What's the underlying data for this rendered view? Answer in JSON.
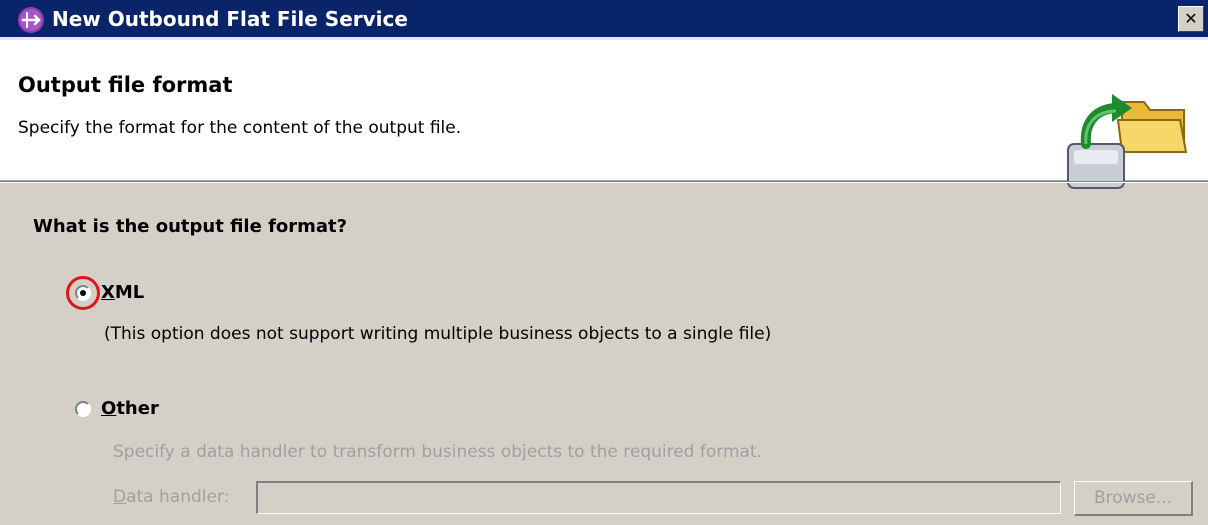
{
  "window": {
    "title": "New Outbound Flat File Service",
    "close_glyph": "✕",
    "title_icon": "wizard-app-icon",
    "colors": {
      "titlebar": "#0a246a",
      "panel": "#d4d0c8",
      "highlight_ring": "#e0141e",
      "disabled_text": "#a0a0a0"
    }
  },
  "header": {
    "title": "Output file format",
    "description": "Specify the format for the content of the output file.",
    "icon": "export-to-folder-icon"
  },
  "body": {
    "question": "What is the output file format?",
    "options": [
      {
        "id": "xml",
        "mnemonic": "X",
        "label_rest": "ML",
        "selected": true,
        "highlighted": true,
        "description": "(This option does not support writing multiple business objects to a single file)"
      },
      {
        "id": "other",
        "mnemonic": "O",
        "label_rest": "ther",
        "selected": false,
        "description": "Specify a data handler to transform business objects to the required format.",
        "data_handler": {
          "label_mnemonic": "D",
          "label_rest": "ata handler:",
          "value": "",
          "enabled": false,
          "browse_label": "Browse..."
        }
      }
    ]
  }
}
